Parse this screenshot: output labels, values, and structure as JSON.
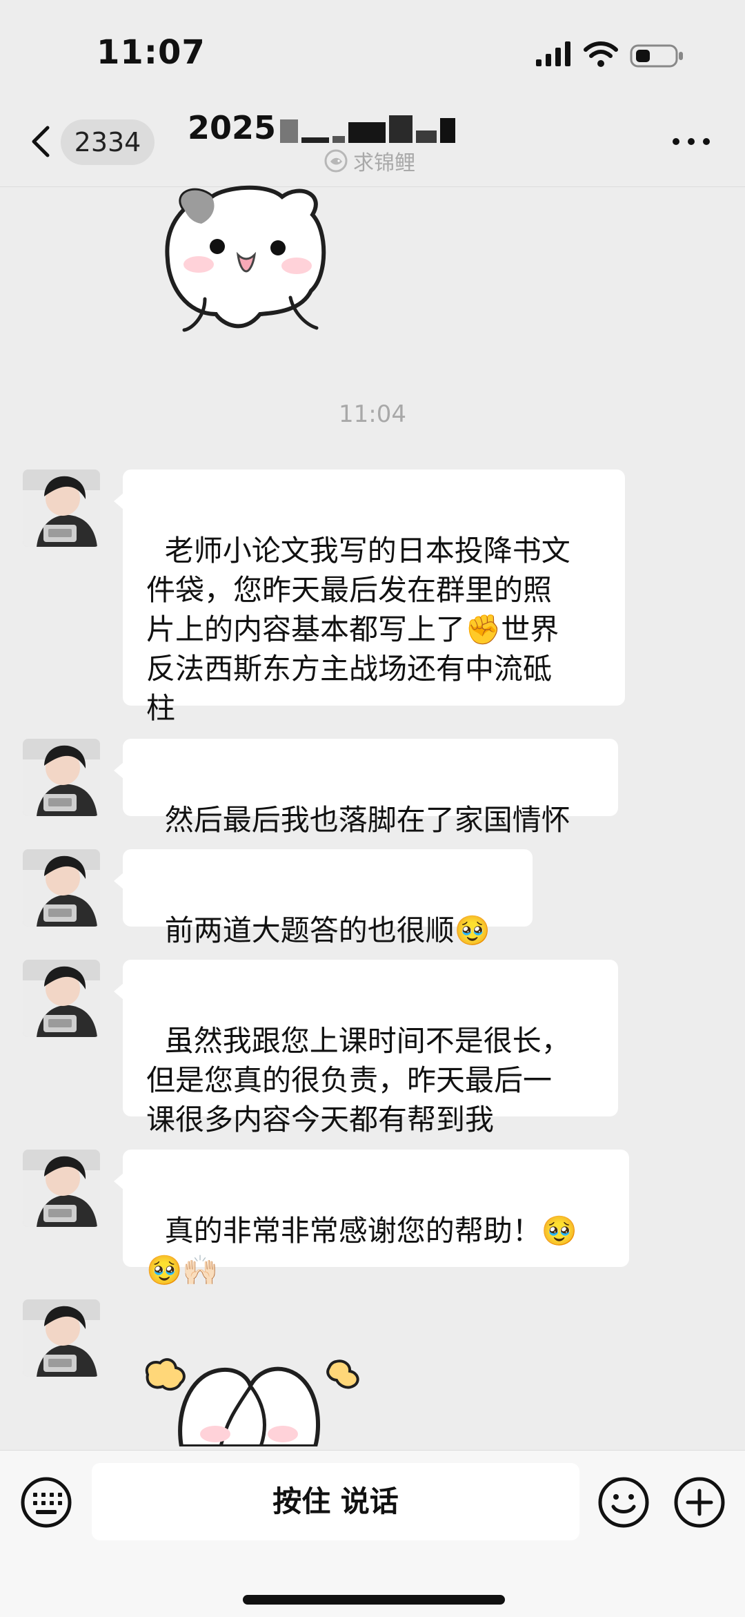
{
  "status_bar": {
    "time": "11:07"
  },
  "nav": {
    "unread_count": "2334",
    "title": "2025",
    "subtitle": "求锦鲤"
  },
  "conversation": {
    "timestamp": "11:04",
    "messages": [
      {
        "text": "老师小论文我写的日本投降书文\n件袋，您昨天最后发在群里的照\n片上的内容基本都写上了✊世界\n反法西斯东方主战场还有中流砥\n柱"
      },
      {
        "text": "然后最后我也落脚在了家国情怀"
      },
      {
        "text": "前两道大题答的也很顺🥹"
      },
      {
        "text": "虽然我跟您上课时间不是很长，\n但是您真的很负责，昨天最后一\n课很多内容今天都有帮到我"
      },
      {
        "text": "真的非常非常感谢您的帮助！🥹\n🥹🙌🏻"
      }
    ]
  },
  "input_bar": {
    "hold_to_talk_label": "按住 说话"
  },
  "icons": {
    "back": "chevron-left-icon",
    "more": "more-horizontal-icon",
    "keyboard": "keyboard-icon",
    "emoji": "smile-icon",
    "plus": "plus-icon",
    "subtitle": "lucky-fish-icon"
  },
  "colors": {
    "chat_background": "#ededed",
    "bubble_background": "#ffffff",
    "badge_background": "#dcdcdc",
    "muted_text": "#a8a8a8"
  }
}
